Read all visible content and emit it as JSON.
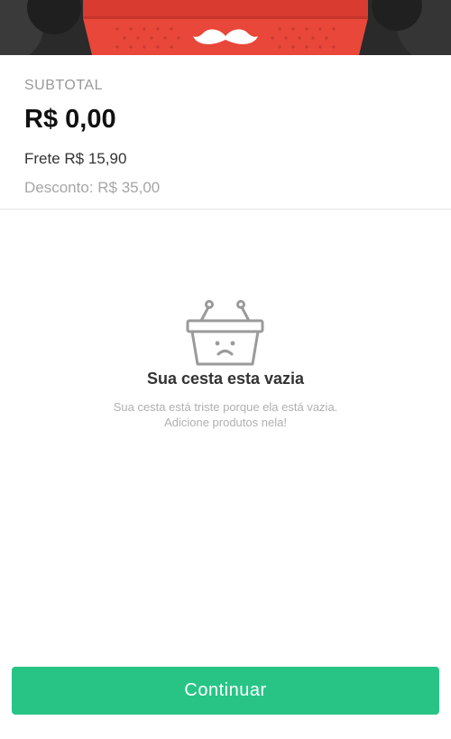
{
  "summary": {
    "subtotal_label": "SUBTOTAL",
    "subtotal_value": "R$ 0,00",
    "frete": "Frete R$ 15,90",
    "desconto": "Desconto: R$ 35,00"
  },
  "empty_state": {
    "icon": "sad-basket-icon",
    "title": "Sua cesta esta vazia",
    "message_line1": "Sua cesta está triste porque ela está vazia.",
    "message_line2": "Adicione produtos nela!"
  },
  "footer": {
    "continue_label": "Continuar"
  },
  "colors": {
    "accent": "#27c486",
    "basket": "#e8473a",
    "header_bg": "#2b2b2b"
  }
}
